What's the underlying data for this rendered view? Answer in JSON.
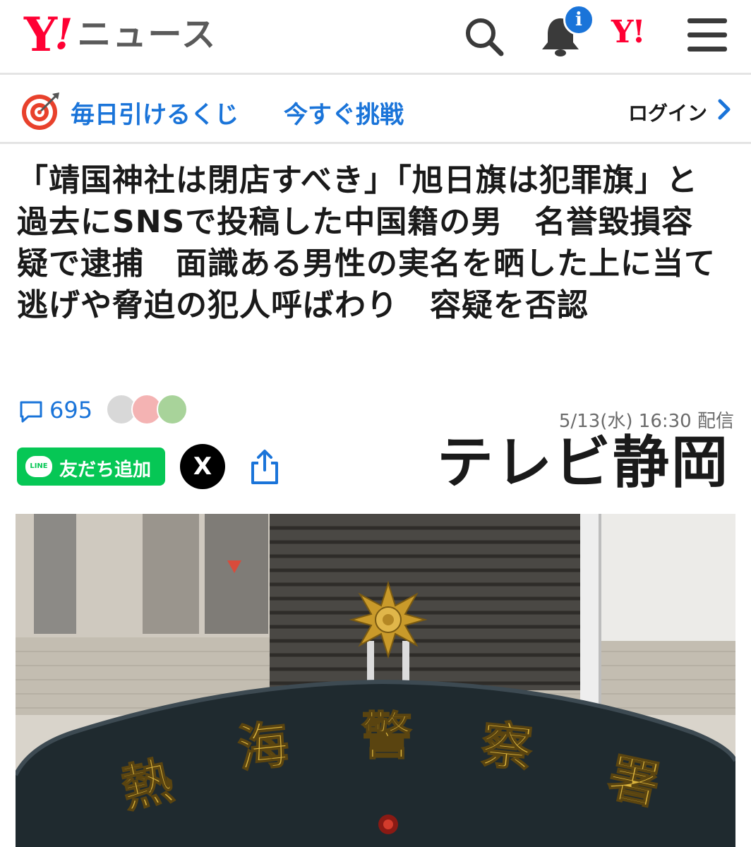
{
  "header": {
    "logo_y": "Y",
    "logo_ex": "!",
    "logo_text": "ニュース",
    "notification_badge": "i",
    "yahoo_small": "Y!"
  },
  "promo": {
    "text_a": "毎日引けるくじ",
    "text_b": "今すぐ挑戦",
    "login": "ログイン"
  },
  "article": {
    "title": "「靖国神社は閉店すべき」「旭日旗は犯罪旗」と過去にSNSで投稿した中国籍の男　名誉毀損容疑で逮捕　面識ある男性の実名を晒した上に当て逃げや脅迫の犯人呼ばわり　容疑を否認",
    "comment_count": "695",
    "date": "5/13(水) 16:30 配信",
    "publisher": "テレビ静岡"
  },
  "share": {
    "line_icon_text": "LINE",
    "line_label": "友だち追加",
    "x_label": "X"
  },
  "photo": {
    "sign_chars": [
      "熱",
      "海",
      "警",
      "察",
      "署"
    ]
  },
  "colors": {
    "brand_red": "#ff0033",
    "link_blue": "#1a74d9",
    "line_green": "#06c755"
  }
}
